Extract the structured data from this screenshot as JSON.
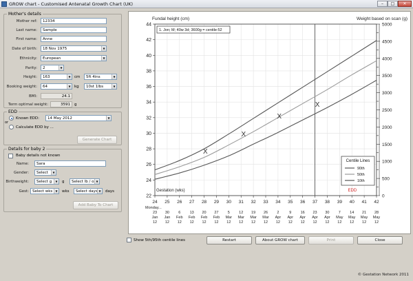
{
  "window": {
    "title": "GROW chart - Customised Antenatal Growth Chart (UK)",
    "controls": [
      "–",
      "□",
      "✕"
    ]
  },
  "mother": {
    "legend": "Mother's details",
    "ref_label": "Mother ref:",
    "ref_value": "12334",
    "lastname_label": "Last name:",
    "lastname_value": "Sample",
    "firstname_label": "First name:",
    "firstname_value": "Anne",
    "dob_label": "Date of birth:",
    "dob_value": "18 Nov 1975",
    "ethnicity_label": "Ethnicity:",
    "ethnicity_value": "European",
    "parity_label": "Parity:",
    "parity_value": "2",
    "height_label": "Height:",
    "height_value": "163",
    "height_unit": "cm",
    "height_imperial": "5ft 4ins",
    "weight_label": "Booking weight:",
    "weight_value": "64",
    "weight_unit": "kg",
    "weight_imperial": "10st 1lbs",
    "bmi_label": "BMI:",
    "bmi_value": "24.1",
    "tow_label": "Term optimal weight:",
    "tow_value": "3591",
    "tow_unit": "g"
  },
  "edd": {
    "legend": "EDD",
    "or_label": "or",
    "known_label": "Known EDD:",
    "known_value": "14 May 2012",
    "calc_label": "Calculate EDD by ...",
    "generate_label": "Generate Chart"
  },
  "baby": {
    "legend": "Details for baby 2",
    "unknown_label": "Baby details not known",
    "name_label": "Name:",
    "name_value": "Sara",
    "gender_label": "Gender:",
    "gender_value": "Select",
    "bw_label": "Birthweight:",
    "bw_value": "Select g",
    "bw_unit": "g",
    "bw_imperial": "Select lb / oz",
    "gest_label": "Gest:",
    "gest_weeks": "Select wks",
    "gest_weeks_unit": "wks",
    "gest_days": "Select days",
    "gest_days_unit": "days",
    "add_label": "Add Baby To Chart"
  },
  "chart_data": {
    "type": "line",
    "ylabel_left": "Fundal height (cm)",
    "ylabel_right": "Weight based on scan (g)",
    "info": "1. Jon; M; 40w 3d; 3600g = centile:52",
    "xlabel_inside": "Gestation (wks)",
    "weekday_label": "Monday...",
    "edd_label": "EDD",
    "edd_week": 37,
    "x_range": [
      24,
      42
    ],
    "y_range": [
      22,
      44
    ],
    "y2_range": [
      0,
      5000
    ],
    "y_ticks": [
      22,
      24,
      26,
      28,
      30,
      32,
      34,
      36,
      38,
      40,
      42,
      44
    ],
    "y2_ticks": [
      0,
      250,
      500,
      750,
      1000,
      1250,
      1500,
      1750,
      2000,
      2250,
      2500,
      2750,
      3000,
      3250,
      3500,
      3750,
      4000,
      4250,
      4500,
      4750,
      5000
    ],
    "y2_labels": [
      0,
      500,
      1000,
      1500,
      2000,
      2500,
      3000,
      3500,
      4000,
      4500,
      5000
    ],
    "x_ticks": [
      24,
      25,
      26,
      27,
      28,
      29,
      30,
      31,
      32,
      33,
      34,
      35,
      36,
      37,
      38,
      39,
      40,
      41,
      42
    ],
    "dates": [
      [
        "23",
        "Jan",
        "12"
      ],
      [
        "30",
        "Jan",
        "12"
      ],
      [
        "6",
        "Feb",
        "12"
      ],
      [
        "13",
        "Feb",
        "12"
      ],
      [
        "20",
        "Feb",
        "12"
      ],
      [
        "27",
        "Feb",
        "12"
      ],
      [
        "5",
        "Mar",
        "12"
      ],
      [
        "12",
        "Mar",
        "12"
      ],
      [
        "19",
        "Mar",
        "12"
      ],
      [
        "26",
        "Mar",
        "12"
      ],
      [
        "2",
        "Apr",
        "12"
      ],
      [
        "9",
        "Apr",
        "12"
      ],
      [
        "16",
        "Apr",
        "12"
      ],
      [
        "23",
        "Apr",
        "12"
      ],
      [
        "30",
        "Apr",
        "12"
      ],
      [
        "7",
        "May",
        "12"
      ],
      [
        "14",
        "May",
        "12"
      ],
      [
        "21",
        "May",
        "12"
      ],
      [
        "28",
        "May",
        "12"
      ]
    ],
    "legend_title": "Centile Lines",
    "series": [
      {
        "name": "90th",
        "color": "#555555",
        "x": [
          24,
          26,
          28,
          30,
          32,
          34,
          36,
          38,
          40,
          42
        ],
        "y": [
          25.3,
          26.5,
          28.0,
          29.9,
          31.9,
          33.9,
          35.9,
          37.9,
          39.9,
          41.9
        ]
      },
      {
        "name": "50th",
        "color": "#9a9a9a",
        "x": [
          24,
          26,
          28,
          30,
          32,
          34,
          36,
          38,
          40,
          42
        ],
        "y": [
          24.7,
          25.7,
          26.9,
          28.5,
          30.2,
          32.0,
          33.8,
          35.6,
          37.5,
          39.3
        ]
      },
      {
        "name": "10th",
        "color": "#555555",
        "x": [
          24,
          26,
          28,
          30,
          32,
          34,
          36,
          38,
          40,
          42
        ],
        "y": [
          24.1,
          24.9,
          25.9,
          27.1,
          28.6,
          30.1,
          31.7,
          33.3,
          35.0,
          36.8
        ]
      }
    ],
    "measurements": [
      {
        "x": 28.1,
        "y": 27.7
      },
      {
        "x": 31.2,
        "y": 29.9
      },
      {
        "x": 34.1,
        "y": 32.2
      },
      {
        "x": 37.2,
        "y": 33.7
      }
    ],
    "marker": "X"
  },
  "bottom": {
    "centile_label": "Show 5th/95th centile lines",
    "restart_label": "Restart",
    "about_label": "About GROW chart",
    "print_label": "Print",
    "close_label": "Close"
  },
  "footer": {
    "copyright": "© Gestation Network 2011"
  }
}
